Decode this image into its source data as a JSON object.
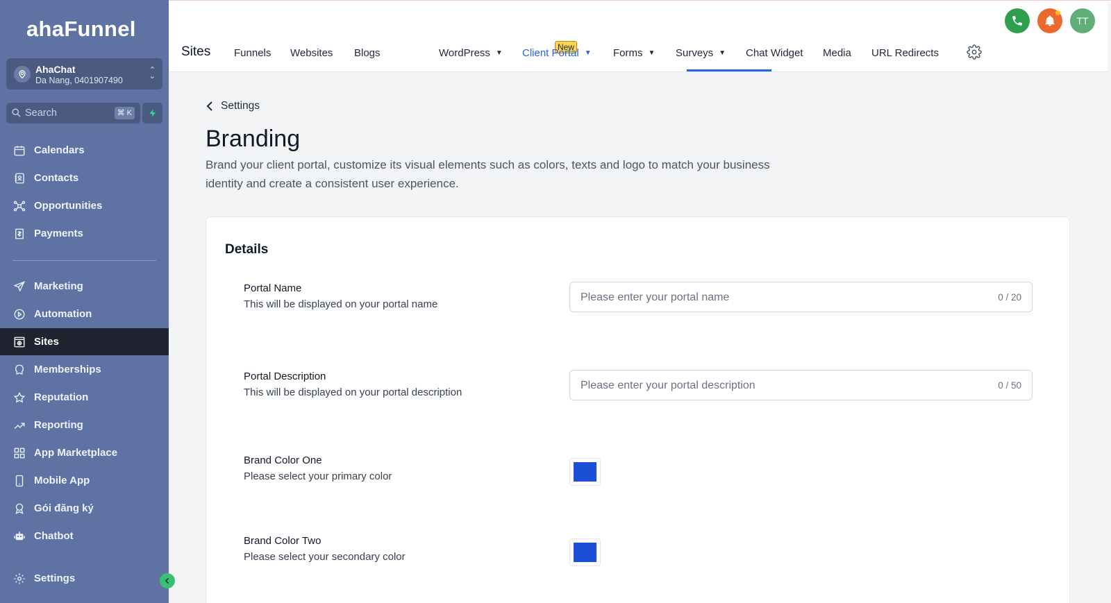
{
  "brand": {
    "logo": "ahaFunnel"
  },
  "account": {
    "name": "AhaChat",
    "location": "Da Nang, 0401907490"
  },
  "search": {
    "placeholder": "Search",
    "shortcut": "⌘ K"
  },
  "sidebar": {
    "items": [
      {
        "label": "Calendars",
        "icon": "calendar-icon"
      },
      {
        "label": "Contacts",
        "icon": "contacts-icon"
      },
      {
        "label": "Opportunities",
        "icon": "opportunities-icon"
      },
      {
        "label": "Payments",
        "icon": "payments-icon"
      },
      {
        "label": "Marketing",
        "icon": "send-icon"
      },
      {
        "label": "Automation",
        "icon": "automation-icon"
      },
      {
        "label": "Sites",
        "icon": "sites-icon",
        "active": true
      },
      {
        "label": "Memberships",
        "icon": "membership-icon"
      },
      {
        "label": "Reputation",
        "icon": "star-icon"
      },
      {
        "label": "Reporting",
        "icon": "chart-line-icon"
      },
      {
        "label": "App Marketplace",
        "icon": "grid-icon"
      },
      {
        "label": "Mobile App",
        "icon": "mobile-icon"
      },
      {
        "label": "Gói đăng ký",
        "icon": "badge-icon"
      },
      {
        "label": "Chatbot",
        "icon": "robot-icon"
      },
      {
        "label": "Settings",
        "icon": "gear-icon"
      }
    ]
  },
  "header": {
    "title": "Sites",
    "tabs": [
      {
        "label": "Funnels"
      },
      {
        "label": "Websites"
      },
      {
        "label": "Blogs",
        "badge": "New"
      },
      {
        "label": "WordPress",
        "dropdown": true
      },
      {
        "label": "Client Portal",
        "dropdown": true,
        "active": true
      },
      {
        "label": "Forms",
        "dropdown": true
      },
      {
        "label": "Surveys",
        "dropdown": true
      },
      {
        "label": "Chat Widget"
      },
      {
        "label": "Media"
      },
      {
        "label": "URL Redirects"
      }
    ],
    "avatar_initials": "TT"
  },
  "page": {
    "back_label": "Settings",
    "title": "Branding",
    "description": "Brand your client portal, customize its visual elements such as colors, texts and logo to match your business identity and create a consistent user experience."
  },
  "details": {
    "title": "Details",
    "portal_name": {
      "label": "Portal Name",
      "help": "This will be displayed on your portal name",
      "placeholder": "Please enter your portal name",
      "count": "0 / 20"
    },
    "portal_description": {
      "label": "Portal Description",
      "help": "This will be displayed on your portal description",
      "placeholder": "Please enter your portal description",
      "count": "0 / 50"
    },
    "brand_color_one": {
      "label": "Brand Color One",
      "help": "Please select your primary color",
      "color": "#1d4ed8"
    },
    "brand_color_two": {
      "label": "Brand Color Two",
      "help": "Please select your secondary color",
      "color": "#1d4ed8"
    }
  },
  "colors": {
    "sidebar": "#5e73a3",
    "accent": "#2563eb",
    "active_nav": "#1f2430"
  }
}
